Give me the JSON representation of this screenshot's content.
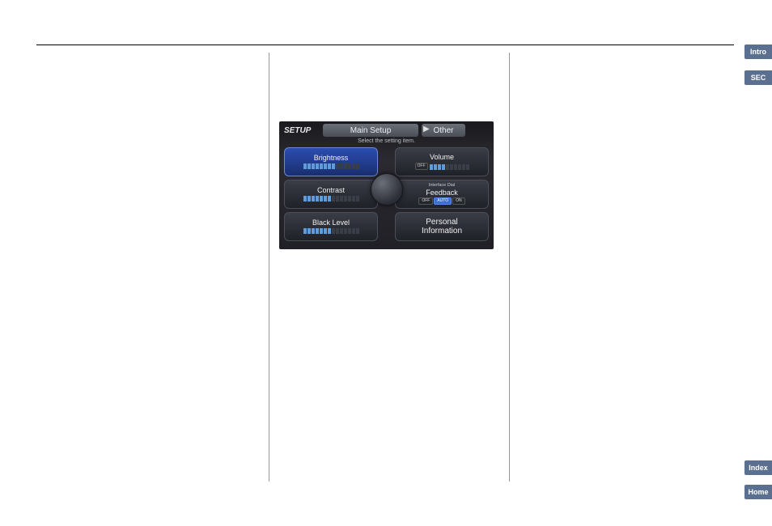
{
  "nav": {
    "intro": "Intro",
    "sec": "SEC",
    "index": "Index",
    "home": "Home"
  },
  "setup_screen": {
    "title": "SETUP",
    "tab_main": "Main Setup",
    "tab_other": "Other",
    "subtitle": "Select the setting item.",
    "panels": {
      "brightness": {
        "label": "Brightness",
        "level": 8,
        "max": 14
      },
      "contrast": {
        "label": "Contrast",
        "level": 7,
        "max": 14
      },
      "black": {
        "label": "Black Level",
        "level": 7,
        "max": 14
      },
      "volume": {
        "label": "Volume",
        "off": "OFF",
        "level": 4,
        "max": 10
      },
      "feedback": {
        "tiny": "Interface Dial",
        "label": "Feedback",
        "off": "OFF",
        "auto": "AUTO",
        "on": "ON"
      },
      "personal": {
        "line1": "Personal",
        "line2": "Information"
      }
    }
  }
}
